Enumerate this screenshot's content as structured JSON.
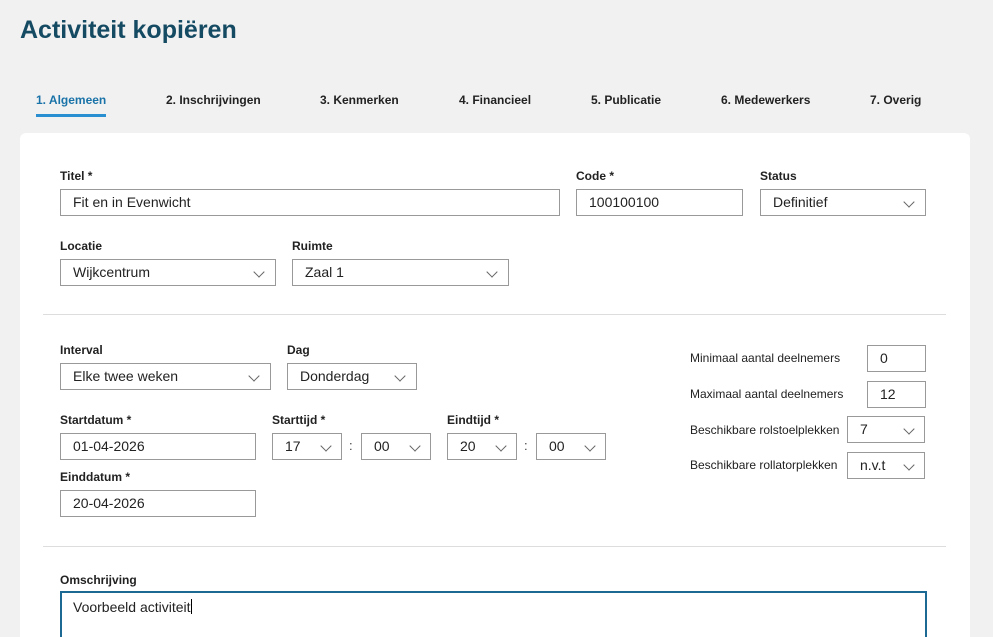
{
  "page": {
    "title": "Activiteit kopiëren"
  },
  "tabs": [
    {
      "label": "1. Algemeen",
      "active": true
    },
    {
      "label": "2. Inschrijvingen"
    },
    {
      "label": "3. Kenmerken"
    },
    {
      "label": "4. Financieel"
    },
    {
      "label": "5. Publicatie"
    },
    {
      "label": "6. Medewerkers"
    },
    {
      "label": "7. Overig"
    }
  ],
  "general": {
    "title_label": "Titel *",
    "title_value": "Fit en in Evenwicht",
    "code_label": "Code *",
    "code_value": "100100100",
    "status_label": "Status",
    "status_value": "Definitief",
    "location_label": "Locatie",
    "location_value": "Wijkcentrum",
    "room_label": "Ruimte",
    "room_value": "Zaal 1"
  },
  "schedule": {
    "interval_label": "Interval",
    "interval_value": "Elke twee weken",
    "day_label": "Dag",
    "day_value": "Donderdag",
    "startdate_label": "Startdatum *",
    "startdate_value": "01-04-2026",
    "starttime_label": "Starttijd *",
    "start_hour": "17",
    "start_minute": "00",
    "endtime_label": "Eindtijd *",
    "end_hour": "20",
    "end_minute": "00",
    "enddate_label": "Einddatum *",
    "enddate_value": "20-04-2026",
    "time_separator": ":"
  },
  "capacity": {
    "min_label": "Minimaal aantal deelnemers",
    "min_value": "0",
    "max_label": "Maximaal aantal deelnemers",
    "max_value": "12",
    "wheelchair_label": "Beschikbare rolstoelplekken",
    "wheelchair_value": "7",
    "rollator_label": "Beschikbare rollatorplekken",
    "rollator_value": "n.v.t"
  },
  "description": {
    "label": "Omschrijving",
    "value": "Voorbeeld activiteit"
  },
  "colors": {
    "title": "#154a63",
    "active_tab": "#1a73a8",
    "tab_underline": "#2a8fd1",
    "focus_border": "#1c6a93"
  }
}
